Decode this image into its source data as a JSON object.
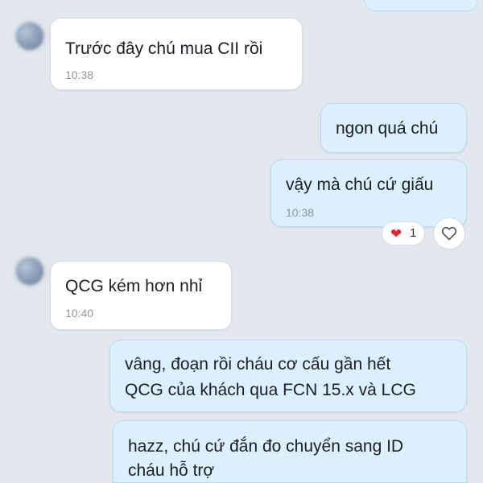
{
  "messages": [
    {
      "sender": "other",
      "text": "Trước đây chú mua CII rồi",
      "time": "10:38"
    },
    {
      "sender": "me",
      "text": "ngon quá chú"
    },
    {
      "sender": "me",
      "text": "vậy mà chú cứ giấu",
      "time": "10:38",
      "reaction": {
        "icon": "heart-icon",
        "emoji": "❤",
        "count": "1"
      }
    },
    {
      "sender": "other",
      "text": "QCG kém hơn nhỉ",
      "time": "10:40"
    },
    {
      "sender": "me",
      "lines": [
        "vâng, đoạn rồi cháu cơ cấu gần hết",
        "QCG của khách qua FCN 15.x và LCG"
      ]
    },
    {
      "sender": "me",
      "lines": [
        "hazz, chú cứ đắn đo chuyển sang ID",
        "cháu hỗ trợ"
      ]
    }
  ],
  "colors": {
    "background": "#e3e8ef",
    "incoming_bubble": "#ffffff",
    "outgoing_bubble": "#dbeffd",
    "heart": "#e0243c",
    "timestamp": "#8e969f"
  },
  "icons": {
    "react_button": "heart-outline-icon",
    "avatar": "avatar"
  }
}
